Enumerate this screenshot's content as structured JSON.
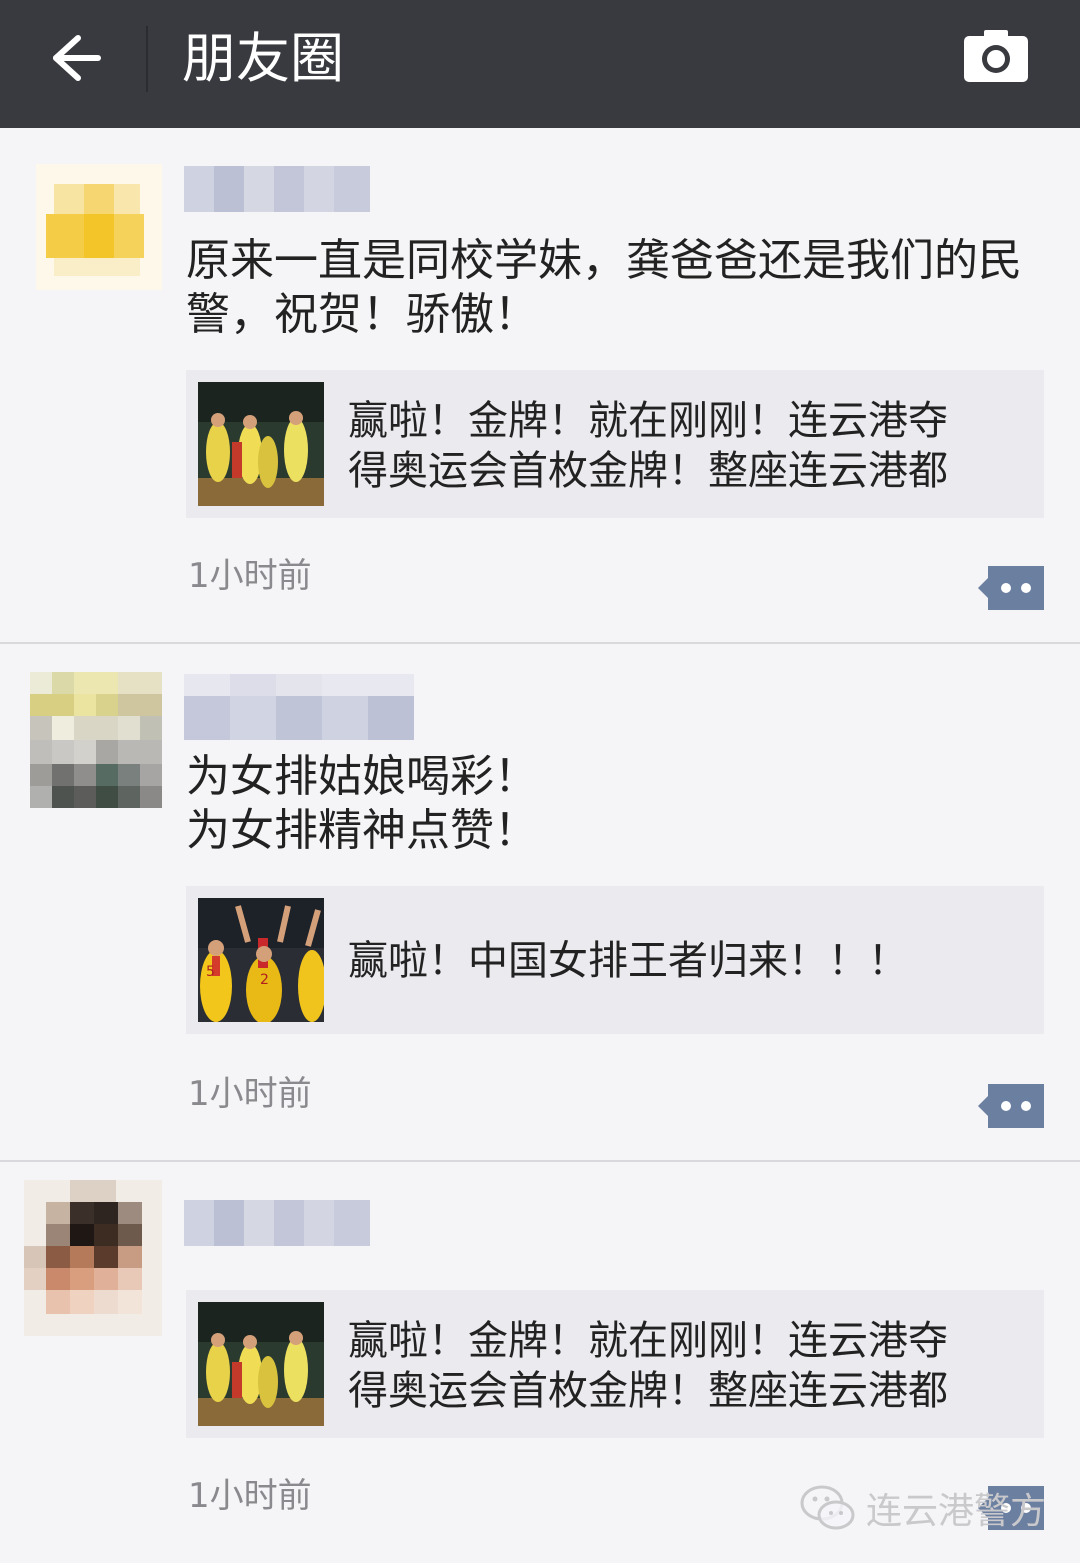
{
  "header": {
    "title": "朋友圈",
    "back_icon": "back-arrow-icon",
    "camera_icon": "camera-icon"
  },
  "posts": [
    {
      "text": "原来一直是同校学妹，龚爸爸还是我们的民\n警，祝贺！骄傲！",
      "card_title": "赢啦！金牌！就在刚刚！连云港夺\n得奥运会首枚金牌！整座连云港都",
      "time": "1小时前"
    },
    {
      "text": "为女排姑娘喝彩！\n为女排精神点赞！",
      "card_title": "赢啦！中国女排王者归来！！！",
      "time": "1小时前"
    },
    {
      "text": "",
      "card_title": "赢啦！金牌！就在刚刚！连云港夺\n得奥运会首枚金牌！整座连云港都",
      "time": "1小时前"
    }
  ],
  "watermark": {
    "text": "连云港警方",
    "icon": "wechat-icon"
  },
  "colors": {
    "topbar": "#393a3f",
    "background": "#f5f4f7",
    "card": "#ebeaef",
    "more_button": "#6b7fa0"
  }
}
